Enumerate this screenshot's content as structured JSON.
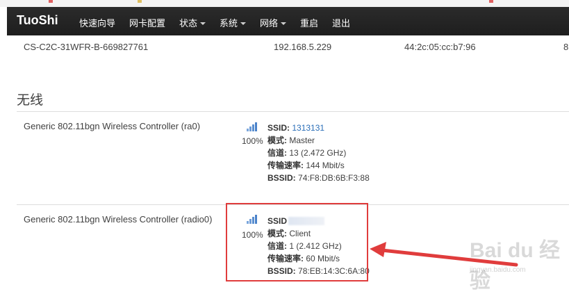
{
  "navbar": {
    "brand": "TuoShi",
    "items": [
      {
        "label": "快速向导",
        "dropdown": false
      },
      {
        "label": "网卡配置",
        "dropdown": false
      },
      {
        "label": "状态",
        "dropdown": true
      },
      {
        "label": "系统",
        "dropdown": true
      },
      {
        "label": "网络",
        "dropdown": true
      },
      {
        "label": "重启",
        "dropdown": false
      },
      {
        "label": "退出",
        "dropdown": false
      }
    ]
  },
  "client_row": {
    "hostname": "CS-C2C-31WFR-B-669827761",
    "ip": "192.168.5.229",
    "mac": "44:2c:05:cc:b7:96",
    "extra": "8"
  },
  "wireless": {
    "title": "无线",
    "devices": [
      {
        "name": "Generic 802.11bgn Wireless Controller (ra0)",
        "signal": "100%",
        "ssid_label": "SSID:",
        "ssid": "1313131",
        "mode_label": "模式:",
        "mode": "Master",
        "channel_label": "信道:",
        "channel": "13 (2.472 GHz)",
        "rate_label": "传输速率:",
        "rate": "144 Mbit/s",
        "bssid_label": "BSSID:",
        "bssid": "74:F8:DB:6B:F3:88"
      },
      {
        "name": "Generic 802.11bgn Wireless Controller (radio0)",
        "signal": "100%",
        "ssid_label": "SSID",
        "mode_label": "模式:",
        "mode": "Client",
        "channel_label": "信道:",
        "channel": "1 (2.412 GHz)",
        "rate_label": "传输速率:",
        "rate": "60 Mbit/s",
        "bssid_label": "BSSID:",
        "bssid": "78:EB:14:3C:6A:80"
      }
    ]
  },
  "watermark": {
    "logo": "Bai du 经验",
    "url": "jingyan.baidu.com"
  },
  "colors": {
    "navbar": "#222222",
    "link": "#2a6eb8",
    "highlight": "#e03c3c",
    "signal": "#5b8fd0"
  },
  "icons": [
    "signal-bars-icon",
    "caret-down-icon"
  ]
}
